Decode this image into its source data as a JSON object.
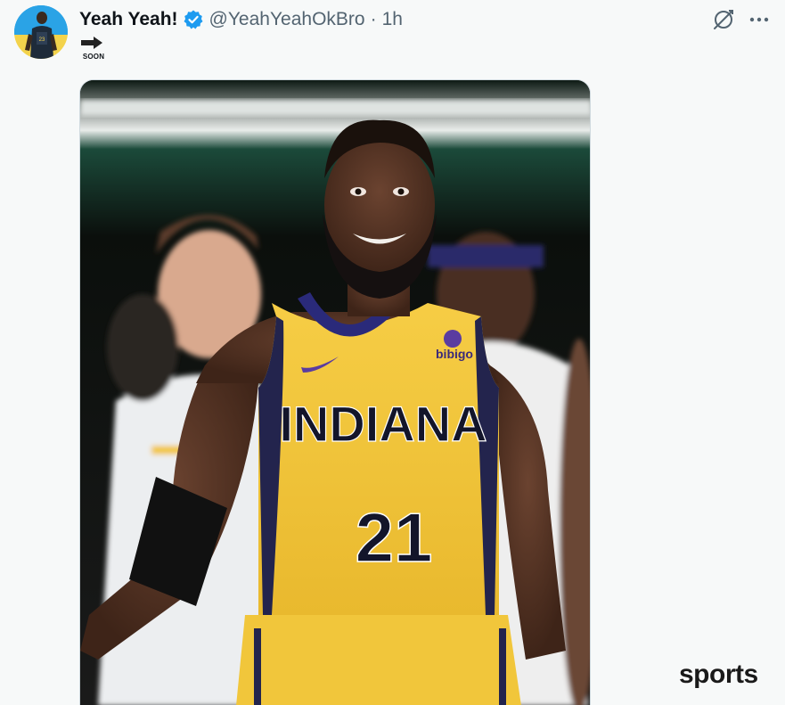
{
  "tweet": {
    "display_name": "Yeah Yeah!",
    "handle": "@YeahYeahOkBro",
    "separator": "·",
    "time": "1h",
    "body_caption": "SOON"
  },
  "jersey": {
    "team": "INDIANA",
    "number": "21",
    "sponsor": "bibigo"
  },
  "watermark": "sports",
  "icons": {
    "verified": "verified-badge-icon",
    "grok": "grok-icon",
    "more": "more-options-icon",
    "arrow": "right-arrow-icon"
  },
  "colors": {
    "verified_blue": "#1d9bf0",
    "jersey_yellow": "#f2c63a",
    "jersey_navy": "#1c2340"
  }
}
